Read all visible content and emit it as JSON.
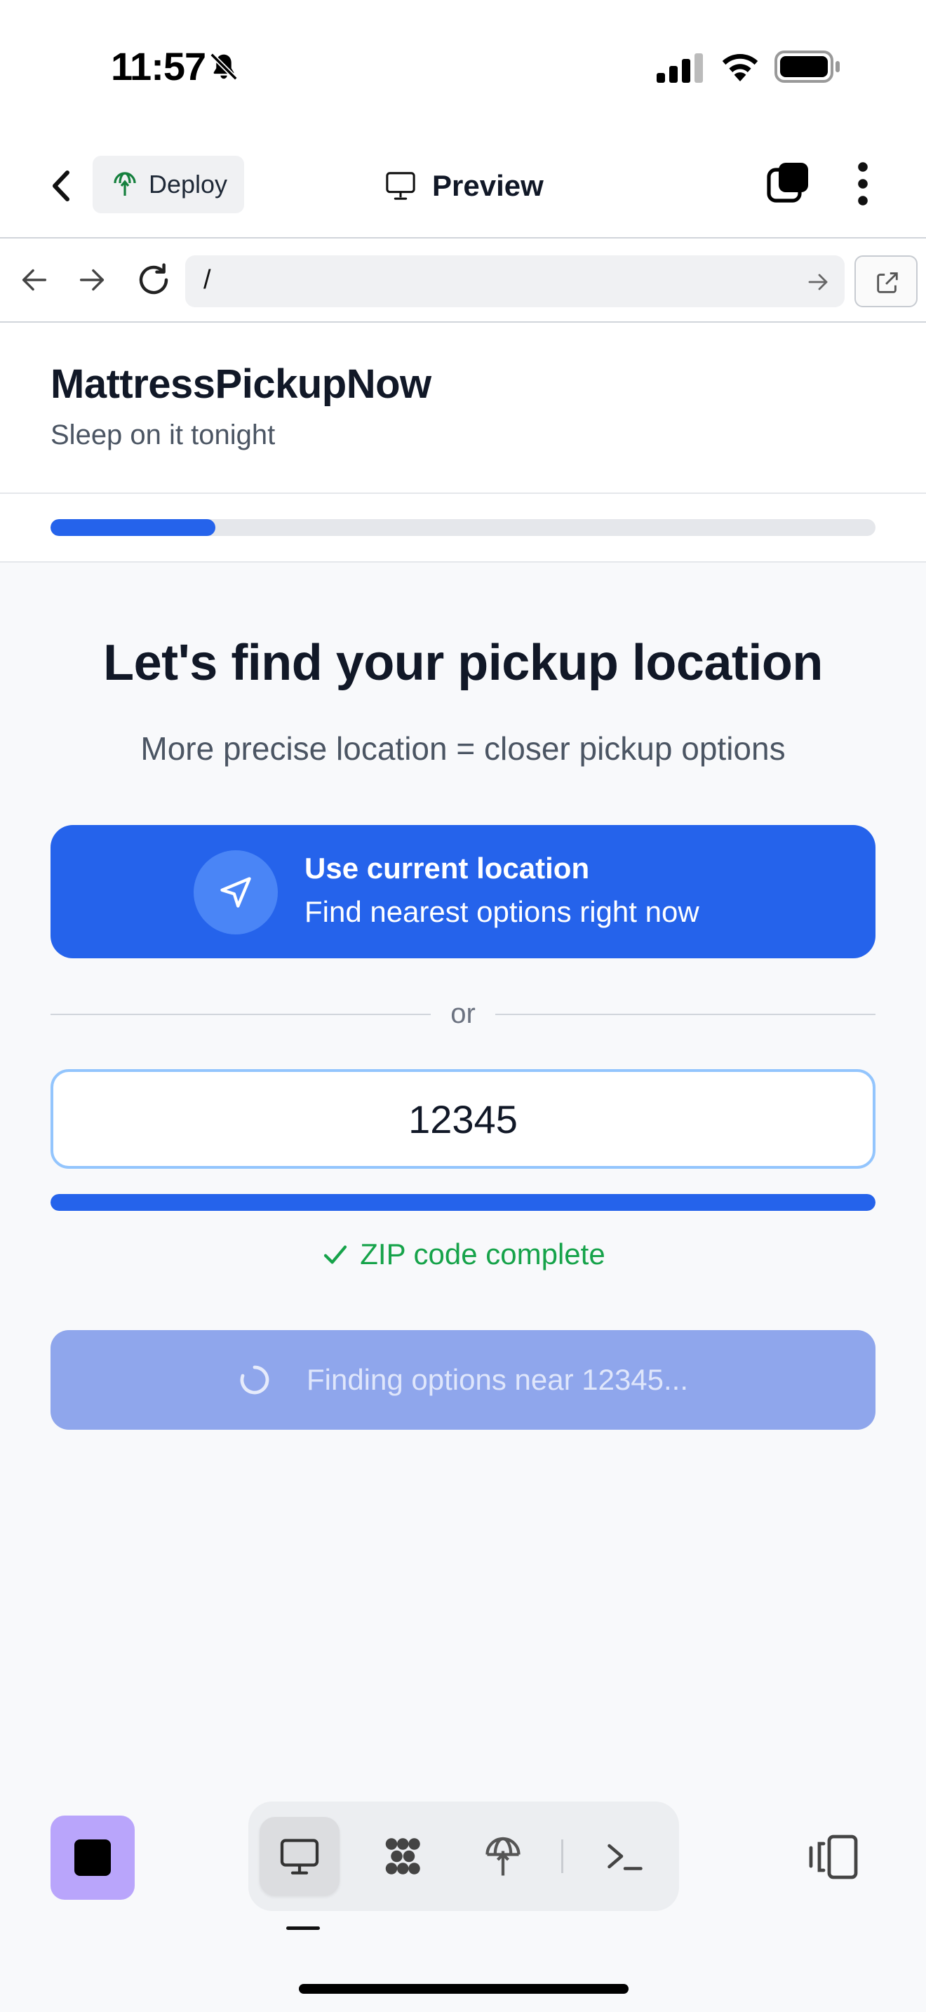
{
  "status_bar": {
    "time": "11:57"
  },
  "app_header": {
    "deploy_label": "Deploy",
    "preview_label": "Preview"
  },
  "browser": {
    "url": "/"
  },
  "site": {
    "name": "MattressPickupNow",
    "tagline": "Sleep on it tonight",
    "progress_fraction": 0.2
  },
  "main": {
    "title": "Let's find your pickup location",
    "subtitle": "More precise location = closer pickup options",
    "use_location": {
      "title": "Use current location",
      "subtitle": "Find nearest options right now"
    },
    "or_label": "or",
    "zip": {
      "value": "12345",
      "progress_fraction": 1.0,
      "status": "ZIP code complete"
    },
    "finding_label": "Finding options near 12345..."
  },
  "colors": {
    "primary": "#2563eb",
    "success": "#16a34a",
    "disabled_button": "#8fa6ec",
    "app_icon": "#b9a5fb"
  },
  "icons": {
    "status": [
      "bell-slash-icon",
      "cellular-signal-icon",
      "wifi-icon",
      "battery-icon"
    ],
    "header": [
      "chevron-left-icon",
      "deploy-icon",
      "monitor-icon",
      "tabs-icon",
      "more-vertical-icon"
    ],
    "browser": [
      "arrow-left-icon",
      "arrow-right-icon",
      "reload-icon",
      "arrow-right-small-icon",
      "external-link-icon"
    ],
    "toolbar": [
      "monitor-icon",
      "apps-icon",
      "deploy-icon",
      "terminal-icon",
      "panel-toggle-icon"
    ]
  }
}
